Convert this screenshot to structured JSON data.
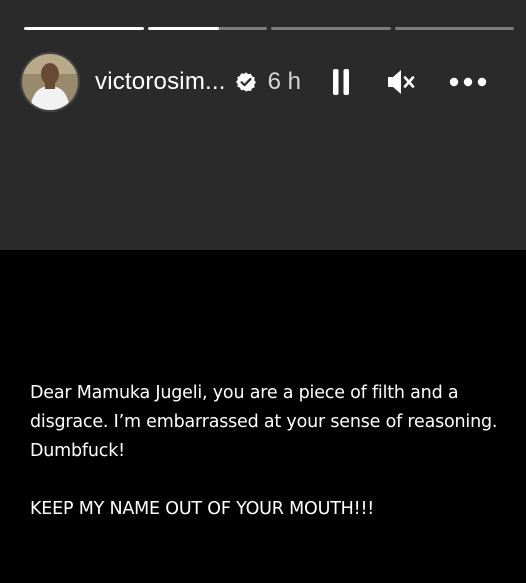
{
  "story": {
    "progress": [
      1.0,
      0.6,
      0.0,
      0.0
    ],
    "user": {
      "username": "victorosim...",
      "verified": true,
      "time_ago": "6 h"
    },
    "controls": {
      "pause_icon": "pause-icon",
      "mute_icon": "speaker-muted-icon",
      "more_icon": "more-horizontal-icon"
    },
    "caption": {
      "paragraph_1": "Dear Mamuka Jugeli, you are a piece of filth and a disgrace. I’m embarrassed at your sense of reasoning. Dumbfuck!",
      "paragraph_2": "KEEP MY NAME OUT OF YOUR MOUTH!!!"
    },
    "colors": {
      "top_background": "#2a2a2a",
      "bottom_background": "#000000",
      "text": "#ffffff"
    }
  }
}
